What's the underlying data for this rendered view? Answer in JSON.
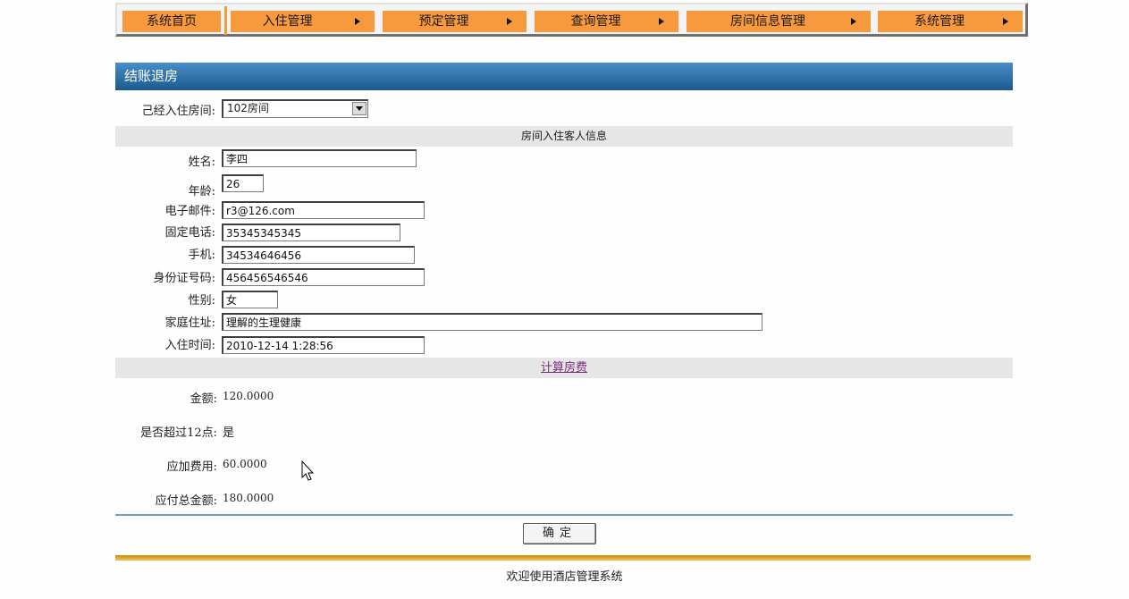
{
  "nav": {
    "home": "系统首页",
    "items": [
      {
        "label": "入住管理"
      },
      {
        "label": "预定管理"
      },
      {
        "label": "查询管理"
      },
      {
        "label": "房间信息管理"
      },
      {
        "label": "系统管理"
      }
    ]
  },
  "panel": {
    "title": "结账退房"
  },
  "room": {
    "label": "己经入住房间:",
    "selected": "102房间"
  },
  "guest_section": {
    "title": "房间入住客人信息"
  },
  "fields": {
    "name": {
      "label": "姓名:",
      "value": "李四"
    },
    "age": {
      "label": "年龄:",
      "value": "26"
    },
    "email": {
      "label": "电子邮件:",
      "value": "r3@126.com"
    },
    "phone": {
      "label": "固定电话:",
      "value": "35345345345"
    },
    "mobile": {
      "label": "手机:",
      "value": "34534646456"
    },
    "id_number": {
      "label": "身份证号码:",
      "value": "456456546546"
    },
    "gender": {
      "label": "性别:",
      "value": "女"
    },
    "address": {
      "label": "家庭住址:",
      "value": "理解的生理健康"
    },
    "checkin": {
      "label": "入住时间:",
      "value": "2010-12-14 1:28:56"
    }
  },
  "calc": {
    "link": "计算房费"
  },
  "fees": {
    "amount": {
      "label": "金额:",
      "value": "120.0000"
    },
    "over_noon": {
      "label": "是否超过12点:",
      "value": "是"
    },
    "extra": {
      "label": "应加费用:",
      "value": "60.0000"
    },
    "total": {
      "label": "应付总金额:",
      "value": "180.0000"
    }
  },
  "actions": {
    "confirm": "确定"
  },
  "footer": {
    "text": "欢迎使用酒店管理系统"
  },
  "colors": {
    "nav_orange": "#f7993d",
    "title_blue": "#1a5a8e",
    "footer_gold": "#d48a00"
  }
}
